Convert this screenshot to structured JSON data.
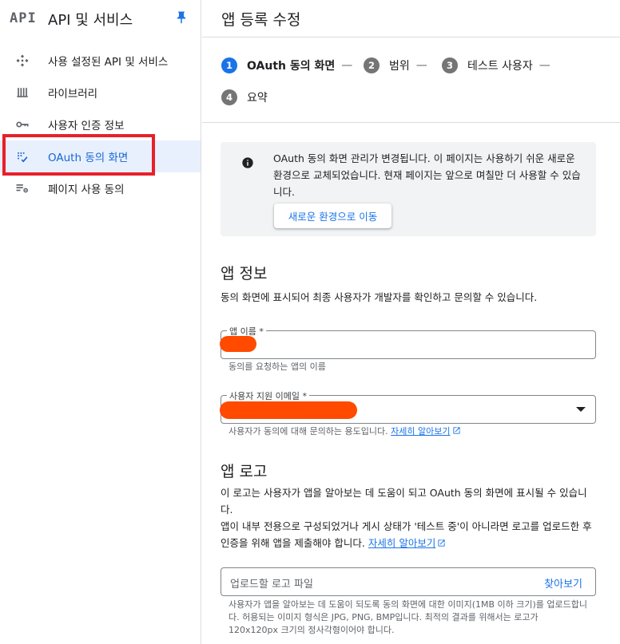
{
  "sidebar": {
    "logo": "API",
    "title": "API 및 서비스",
    "items": [
      {
        "label": "사용 설정된 API 및 서비스",
        "icon": "api-services-icon"
      },
      {
        "label": "라이브러리",
        "icon": "library-icon"
      },
      {
        "label": "사용자 인증 정보",
        "icon": "key-icon"
      },
      {
        "label": "OAuth 동의 화면",
        "icon": "oauth-consent-icon",
        "active": true
      },
      {
        "label": "페이지 사용 동의",
        "icon": "settings-list-icon"
      }
    ]
  },
  "main": {
    "title": "앱 등록 수정",
    "steps": [
      {
        "num": "1",
        "label": "OAuth 동의 화면",
        "active": true
      },
      {
        "num": "2",
        "label": "범위"
      },
      {
        "num": "3",
        "label": "테스트 사용자"
      },
      {
        "num": "4",
        "label": "요약"
      }
    ],
    "step_separator": "—",
    "notice": {
      "text": "OAuth 동의 화면 관리가 변경됩니다. 이 페이지는 사용하기 쉬운 새로운 환경으로 교체되었습니다. 현재 페이지는 앞으로 며칠만 더 사용할 수 있습니다.",
      "button": "새로운 환경으로 이동"
    },
    "app_info": {
      "title": "앱 정보",
      "desc": "동의 화면에 표시되어 최종 사용자가 개발자를 확인하고 문의할 수 있습니다.",
      "app_name_label": "앱 이름 *",
      "app_name_hint": "동의를 요청하는 앱의 이름",
      "email_label": "사용자 지원 이메일 *",
      "email_hint": "사용자가 동의에 대해 문의하는 용도입니다.",
      "learn_more": "자세히 알아보기"
    },
    "app_logo": {
      "title": "앱 로고",
      "desc1": "이 로고는 사용자가 앱을 알아보는 데 도움이 되고 OAuth 동의 화면에 표시될 수 있습니다.",
      "desc2": "앱이 내부 전용으로 구성되었거나 게시 상태가 '테스트 중'이 아니라면 로고를 업로드한 후 인증을 위해 앱을 제출해야 합니다.",
      "learn_more": "자세히 알아보기",
      "upload_placeholder": "업로드할 로고 파일",
      "browse": "찾아보기",
      "hint": "사용자가 앱을 알아보는 데 도움이 되도록 동의 화면에 대한 이미지(1MB 이하 크기)를 업로드합니다. 허용되는 이미지 형식은 JPG, PNG, BMP입니다. 최적의 결과를 위해서는 로고가 120x120px 크기의 정사각형이어야 합니다."
    }
  },
  "colors": {
    "accent": "#1a73e8",
    "active_bg": "#e8f0fe",
    "highlight_box": "#e8202a",
    "redaction": "#ff4a00"
  }
}
